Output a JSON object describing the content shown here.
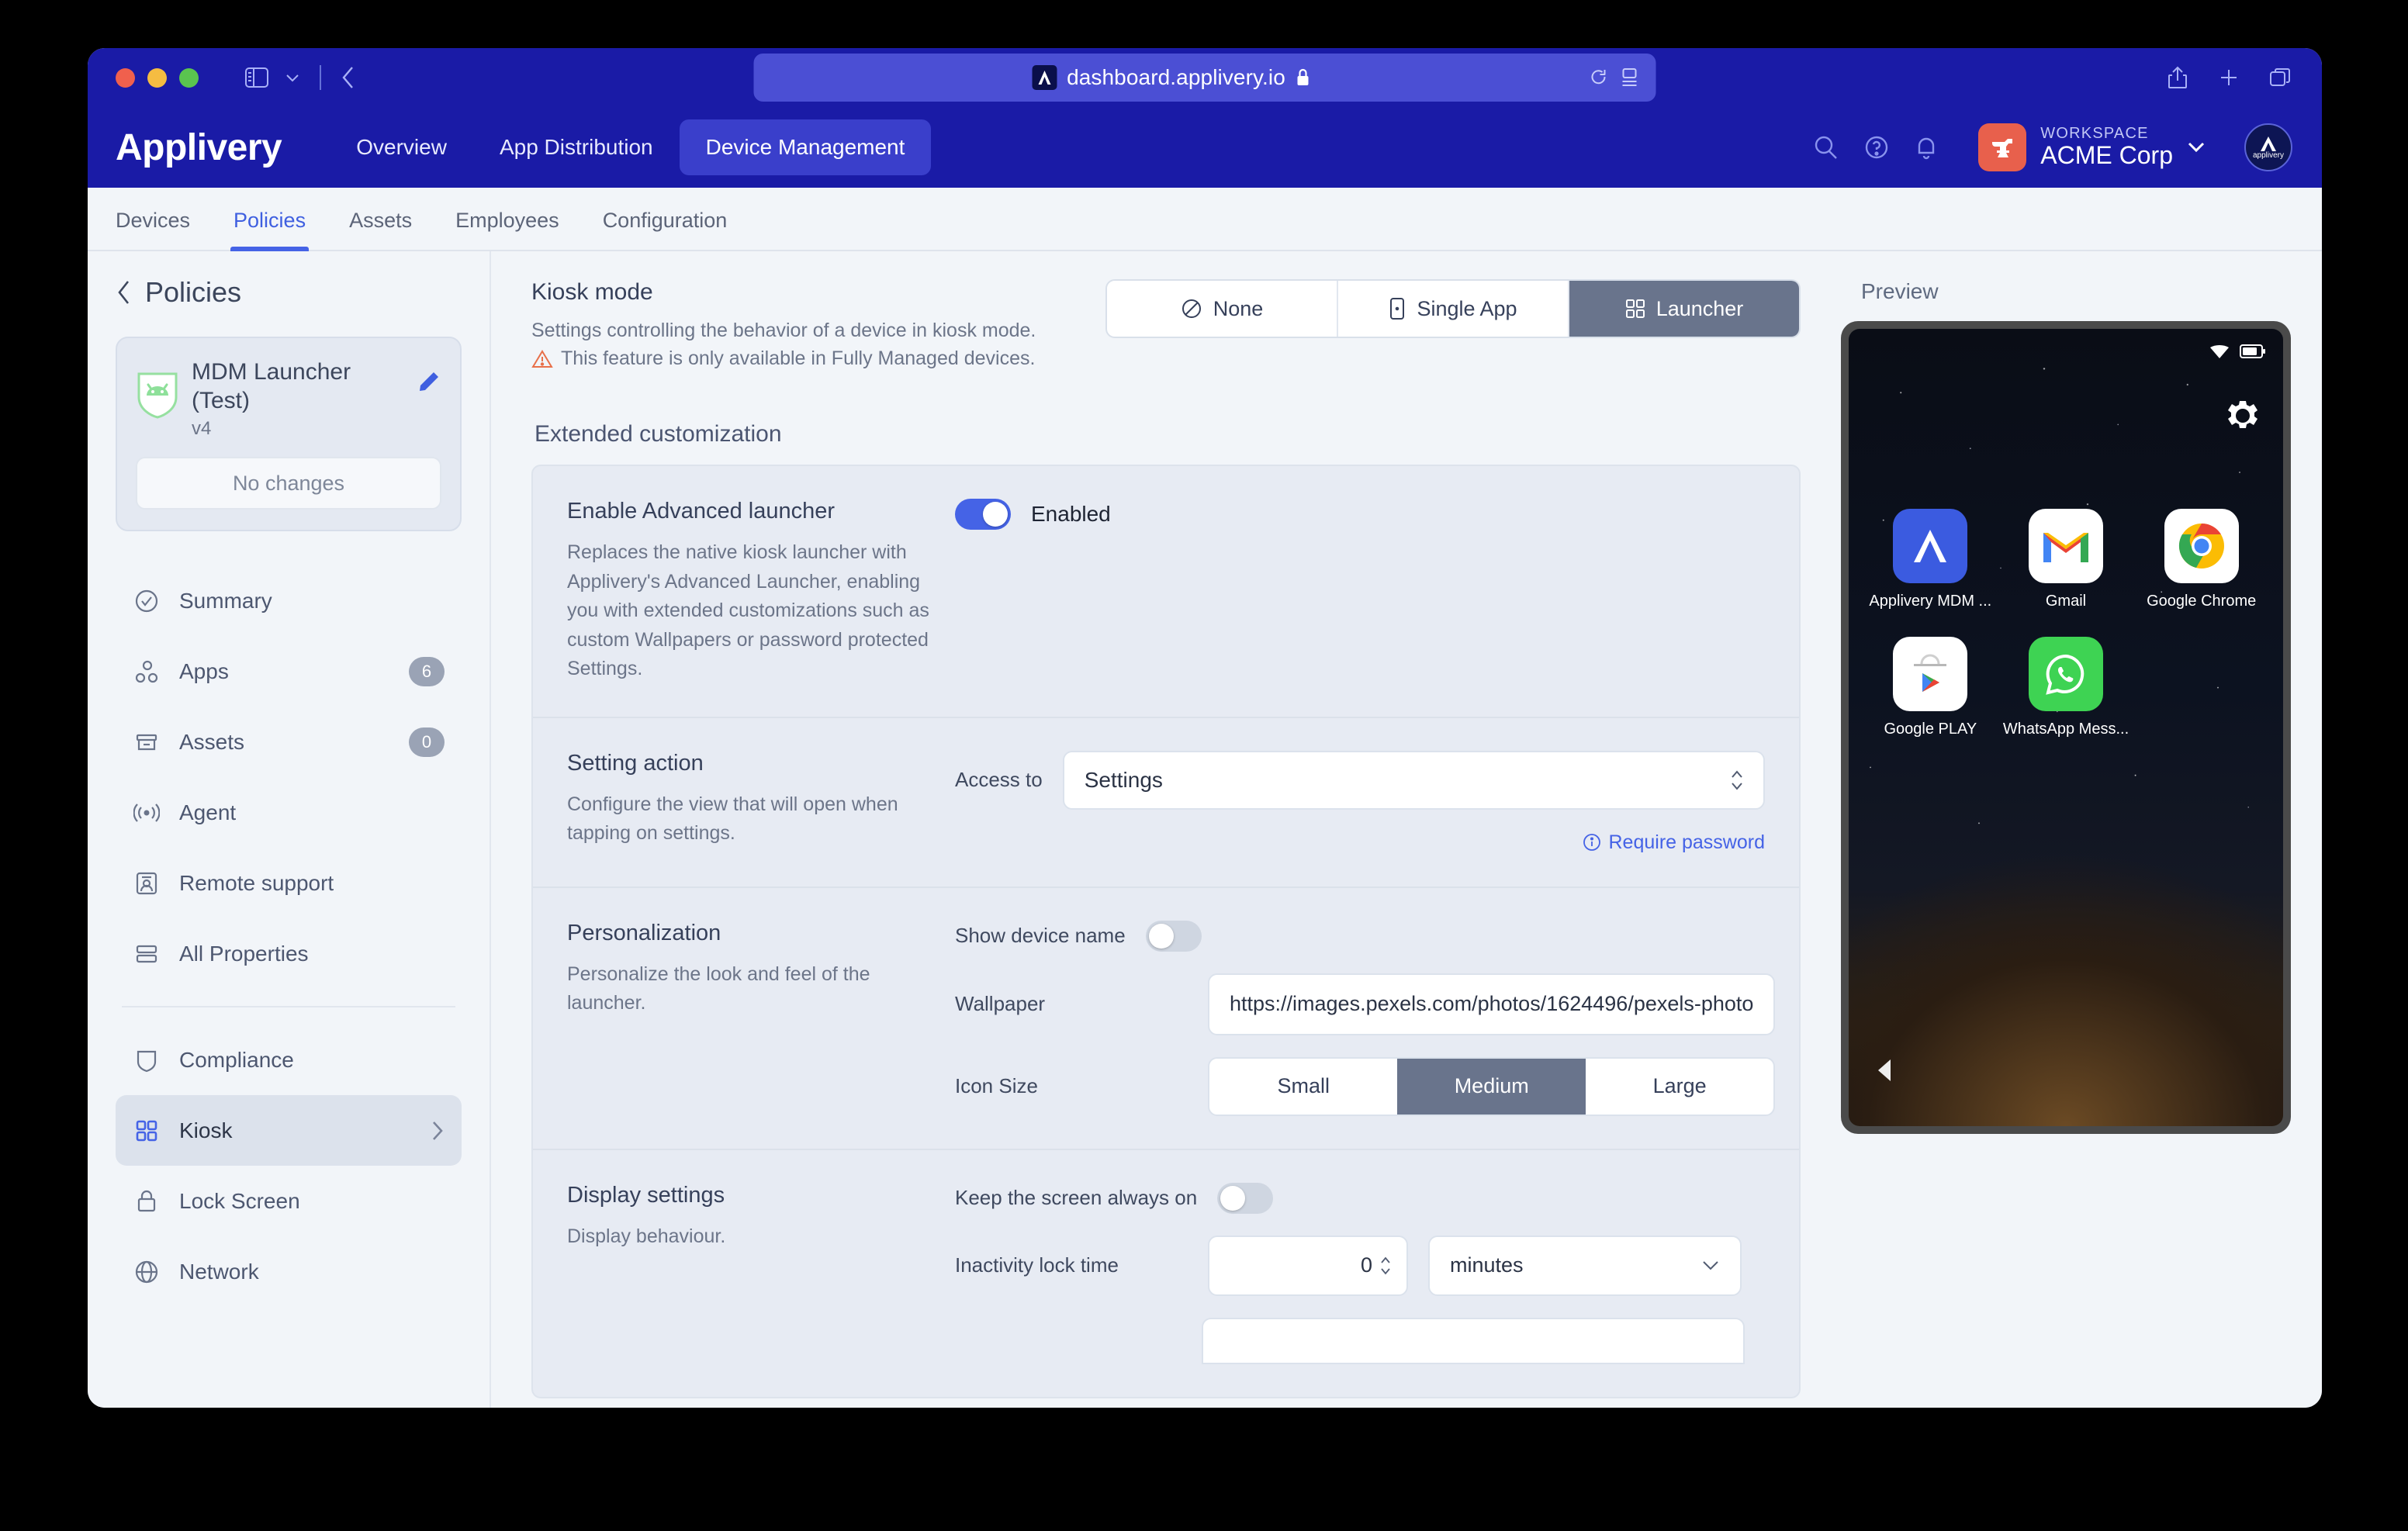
{
  "browser": {
    "url": "dashboard.applivery.io",
    "icons": {
      "sidebar": "sidebar-toggle-icon",
      "chevron": "chevron-down-icon",
      "back": "back-chevron-icon",
      "reload": "reload-icon",
      "reader": "reader-view-icon",
      "share": "share-icon",
      "new_tab": "plus-icon",
      "tabs": "tab-overview-icon",
      "lock": "lock-icon"
    }
  },
  "header": {
    "brand": "Applivery",
    "nav": [
      {
        "label": "Overview",
        "active": false
      },
      {
        "label": "App Distribution",
        "active": false
      },
      {
        "label": "Device Management",
        "active": true
      }
    ],
    "workspace_label": "WORKSPACE",
    "workspace_name": "ACME Corp",
    "avatar_text": "applivery",
    "icons": [
      "search-icon",
      "help-icon",
      "notifications-icon"
    ]
  },
  "subtabs": [
    {
      "label": "Devices",
      "active": false
    },
    {
      "label": "Policies",
      "active": true
    },
    {
      "label": "Assets",
      "active": false
    },
    {
      "label": "Employees",
      "active": false
    },
    {
      "label": "Configuration",
      "active": false
    }
  ],
  "sidebar": {
    "back_label": "Policies",
    "policy": {
      "name": "MDM Launcher (Test)",
      "version": "v4",
      "changes_label": "No changes"
    },
    "items": [
      {
        "label": "Summary",
        "badge": "",
        "selected": false
      },
      {
        "label": "Apps",
        "badge": "6",
        "selected": false
      },
      {
        "label": "Assets",
        "badge": "0",
        "selected": false
      },
      {
        "label": "Agent",
        "badge": "",
        "selected": false
      },
      {
        "label": "Remote support",
        "badge": "",
        "selected": false
      },
      {
        "label": "All Properties",
        "badge": "",
        "selected": false
      },
      {
        "label": "Compliance",
        "badge": "",
        "selected": false
      },
      {
        "label": "Kiosk",
        "badge": "",
        "selected": true
      },
      {
        "label": "Lock Screen",
        "badge": "",
        "selected": false
      },
      {
        "label": "Network",
        "badge": "",
        "selected": false
      }
    ]
  },
  "main": {
    "kiosk": {
      "title": "Kiosk mode",
      "description": "Settings controlling the behavior of a device in kiosk mode.",
      "warning": "This feature is only available in Fully Managed devices.",
      "modes": [
        {
          "label": "None",
          "active": false
        },
        {
          "label": "Single App",
          "active": false
        },
        {
          "label": "Launcher",
          "active": true
        }
      ]
    },
    "extended_title": "Extended customization",
    "advanced_launcher": {
      "title": "Enable Advanced launcher",
      "description": "Replaces the native kiosk launcher with Applivery's Advanced Launcher, enabling you with extended customizations such as custom Wallpapers or password protected Settings.",
      "toggle_state": true,
      "toggle_label": "Enabled"
    },
    "setting_action": {
      "title": "Setting action",
      "description": "Configure the view that will open when tapping on settings.",
      "access_label": "Access to",
      "access_value": "Settings",
      "require_password": "Require password"
    },
    "personalization": {
      "title": "Personalization",
      "description": "Personalize the look and feel of the launcher.",
      "show_device_name_label": "Show device name",
      "show_device_name_state": false,
      "wallpaper_label": "Wallpaper",
      "wallpaper_value": "https://images.pexels.com/photos/1624496/pexels-photo",
      "icon_size_label": "Icon Size",
      "icon_sizes": [
        {
          "label": "Small",
          "active": false
        },
        {
          "label": "Medium",
          "active": true
        },
        {
          "label": "Large",
          "active": false
        }
      ]
    },
    "display_settings": {
      "title": "Display settings",
      "description": "Display behaviour.",
      "keep_screen_label": "Keep the screen always on",
      "keep_screen_state": false,
      "inactivity_label": "Inactivity lock time",
      "inactivity_value": "0",
      "inactivity_unit": "minutes"
    }
  },
  "preview": {
    "label": "Preview",
    "apps": [
      {
        "name": "Applivery MDM ...",
        "icon": "applivery-icon"
      },
      {
        "name": "Gmail",
        "icon": "gmail-icon"
      },
      {
        "name": "Google Chrome",
        "icon": "chrome-icon"
      },
      {
        "name": "Google PLAY",
        "icon": "google-play-icon"
      },
      {
        "name": "WhatsApp Mess...",
        "icon": "whatsapp-icon"
      }
    ],
    "status_icons": [
      "wifi-icon",
      "battery-icon"
    ],
    "settings_icon": "gear-icon",
    "nav_back_icon": "back-triangle-icon"
  },
  "colors": {
    "brand_blue": "#1a1ba6",
    "accent": "#4563e6",
    "segment_active": "#69748c",
    "page_bg": "#f2f5f9"
  }
}
